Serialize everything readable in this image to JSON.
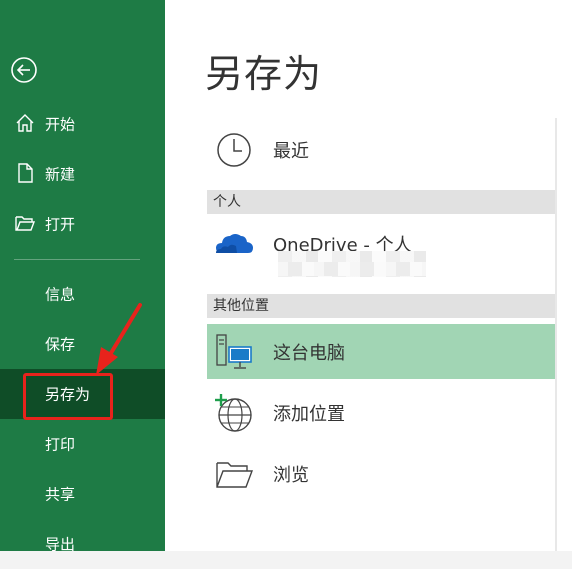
{
  "sidebar": {
    "items": [
      {
        "label": "开始"
      },
      {
        "label": "新建"
      },
      {
        "label": "打开"
      },
      {
        "label": "信息"
      },
      {
        "label": "保存"
      },
      {
        "label": "另存为"
      },
      {
        "label": "打印"
      },
      {
        "label": "共享"
      },
      {
        "label": "导出"
      }
    ],
    "selected": "另存为"
  },
  "main": {
    "title": "另存为",
    "recent": {
      "label": "最近"
    },
    "personal_header": "个人",
    "onedrive": {
      "label": "OneDrive - 个人"
    },
    "other_header": "其他位置",
    "this_pc": {
      "label": "这台电脑"
    },
    "add_place": {
      "label": "添加位置"
    },
    "browse": {
      "label": "浏览"
    }
  },
  "colors": {
    "sidebar_bg": "#1e7b45",
    "sidebar_selected": "#0f4d27",
    "selected_location": "#a1d5b4",
    "annotation": "#e8231c"
  },
  "icons": {
    "back": "back-arrow-icon",
    "home": "home-icon",
    "new": "new-document-icon",
    "open": "open-folder-icon",
    "recent": "clock-icon",
    "onedrive": "cloud-icon",
    "this_pc": "computer-icon",
    "add_place": "globe-plus-icon",
    "browse": "folder-icon"
  }
}
